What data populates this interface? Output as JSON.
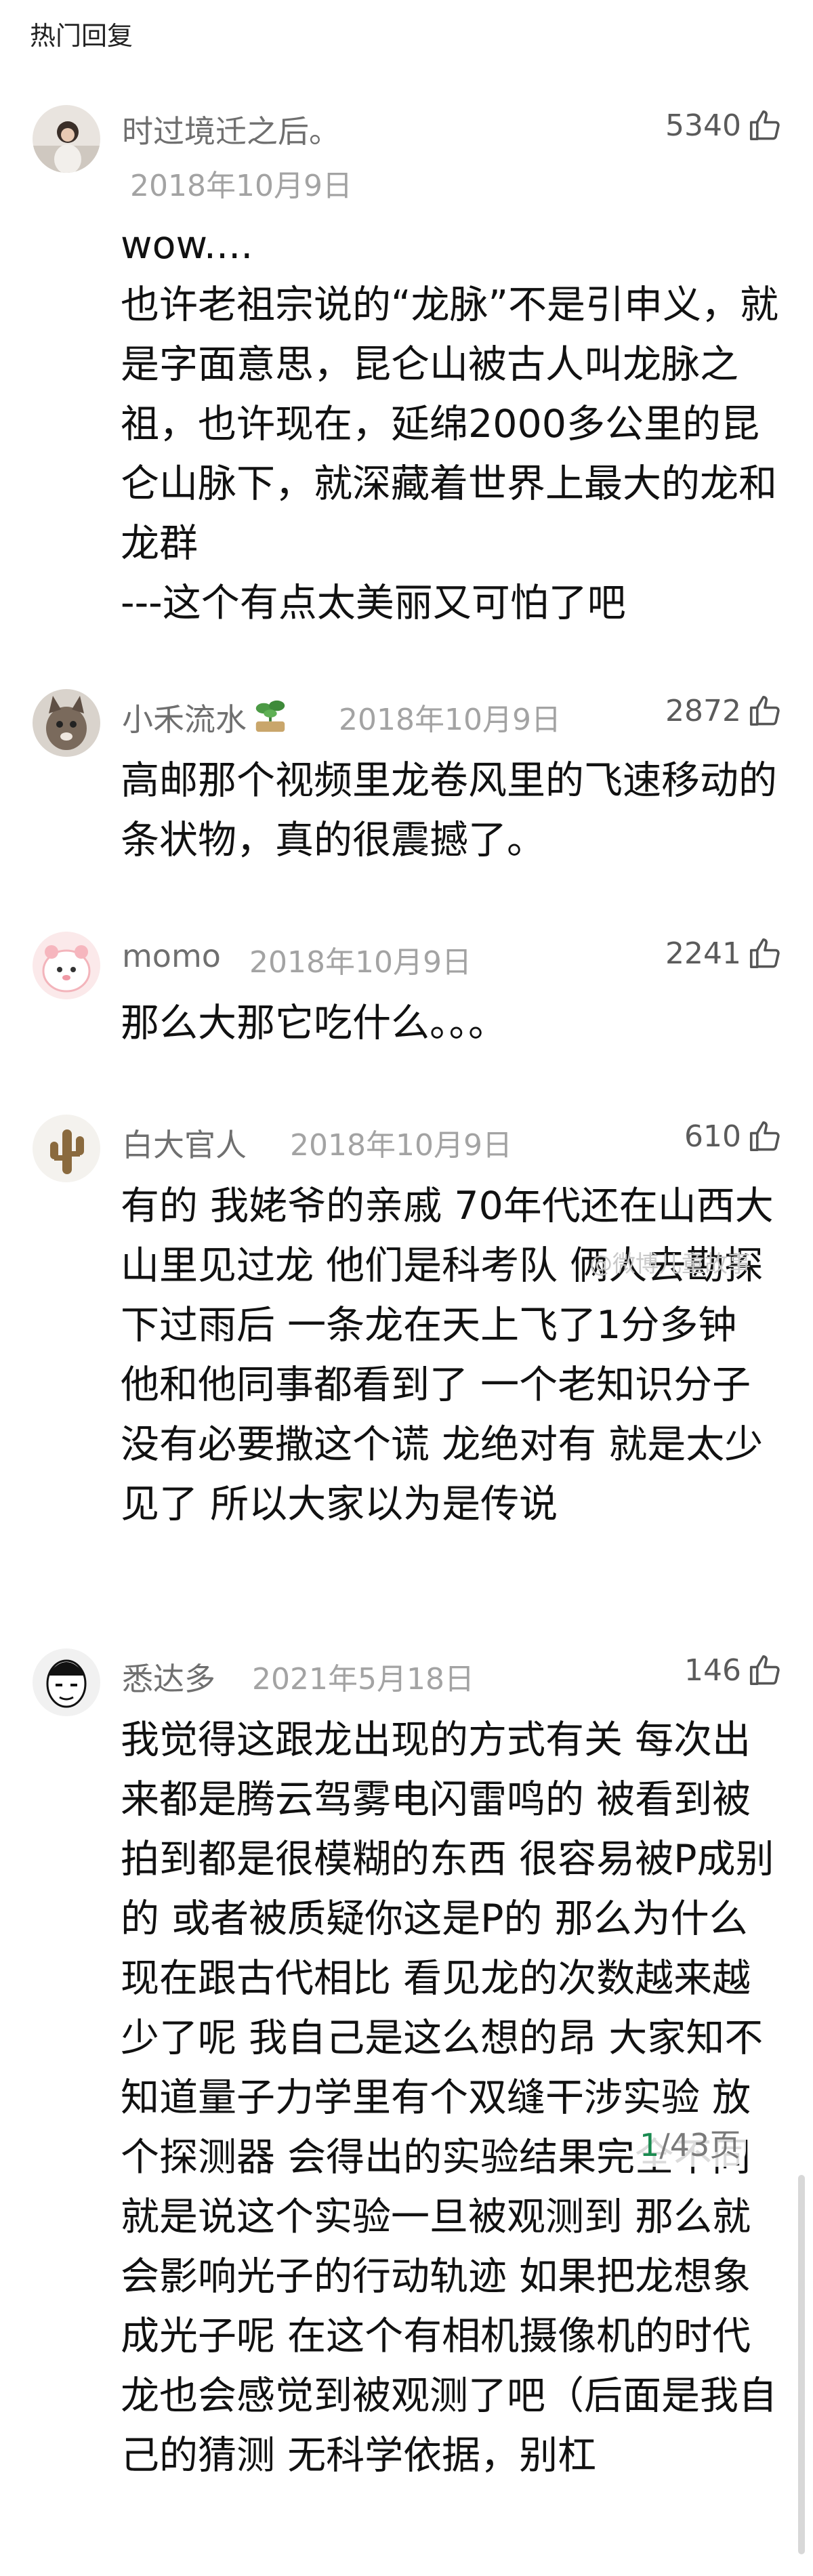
{
  "header": {
    "title": "热门回复"
  },
  "comments": [
    {
      "username": "时过境迁之后。",
      "date": "2018年10月9日",
      "likes": "5340",
      "text": "wow....\n也许老祖宗说的“龙脉”不是引申义，就是字面意思，昆仑山被古人叫龙脉之祖，也许现在，延绵2000多公里的昆仑山脉下，就深藏着世界上最大的龙和龙群\n---这个有点太美丽又可怕了吧"
    },
    {
      "username": "小禾流水",
      "date": "2018年10月9日",
      "likes": "2872",
      "text": "高邮那个视频里龙卷风里的飞速移动的条状物，真的很震撼了。"
    },
    {
      "username": "momo",
      "date": "2018年10月9日",
      "likes": "2241",
      "text": "那么大那它吃什么。。。"
    },
    {
      "username": "白大官人",
      "date": "2018年10月9日",
      "likes": "610",
      "text": "有的 我姥爷的亲戚 70年代还在山西大山里见过龙 他们是科考队 俩人去勘探 下过雨后 一条龙在天上飞了1分多钟 他和他同事都看到了 一个老知识分子 没有必要撒这个谎 龙绝对有 就是太少见了 所以大家以为是传说"
    },
    {
      "username": "悉达多",
      "date": "2021年5月18日",
      "likes": "146",
      "text": "我觉得这跟龙出现的方式有关 每次出来都是腾云驾雾电闪雷鸣的 被看到被拍到都是很模糊的东西 很容易被P成别的 或者被质疑你这是P的 那么为什么现在跟古代相比 看见龙的次数越来越少了呢 我自己是这么想的昂 大家知不知道量子力学里有个双缝干涉实验 放个探测器 会得出的实验结果完全不同 就是说这个实验一旦被观测到 那么就会影响光子的行动轨迹 如果把龙想象成光子呢 在这个有相机摄像机的时代 龙也会感觉到被观测了吧（后面是我自己的猜测 无科学依据，别杠"
    }
  ],
  "pager": {
    "current": "1",
    "total": "/43页"
  },
  "watermark": "@微博儿童故事",
  "icons": {
    "like": "thumbs-up-icon",
    "badge": "plant-badge-icon"
  }
}
